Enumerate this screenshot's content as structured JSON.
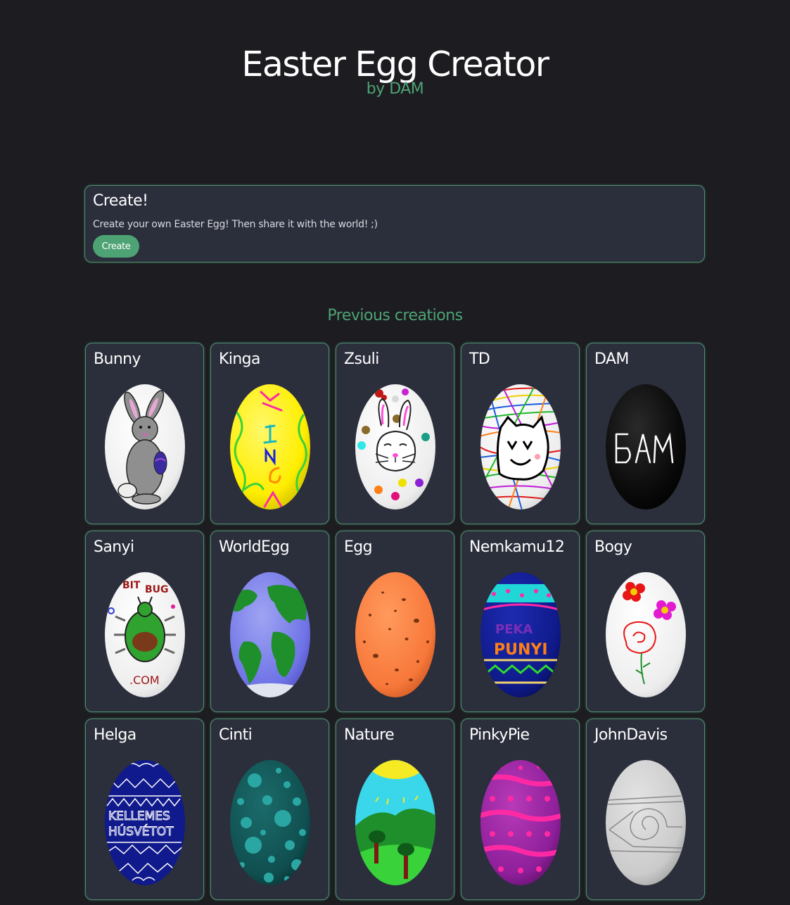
{
  "header": {
    "title": "Easter Egg Creator",
    "subtitle": "by DAM"
  },
  "create": {
    "title": "Create!",
    "description": "Create your own Easter Egg! Then share it with the world! ;)",
    "button_label": "Create"
  },
  "previous": {
    "title": "Previous creations",
    "eggs": [
      {
        "name": "Bunny",
        "icon": "bunny-egg-icon"
      },
      {
        "name": "Kinga",
        "icon": "kinga-egg-icon"
      },
      {
        "name": "Zsuli",
        "icon": "zsuli-egg-icon"
      },
      {
        "name": "TD",
        "icon": "td-egg-icon"
      },
      {
        "name": "DAM",
        "icon": "dam-egg-icon"
      },
      {
        "name": "Sanyi",
        "icon": "sanyi-egg-icon"
      },
      {
        "name": "WorldEgg",
        "icon": "worldegg-egg-icon"
      },
      {
        "name": "Egg",
        "icon": "egg-egg-icon"
      },
      {
        "name": "Nemkamu12",
        "icon": "nemkamu12-egg-icon"
      },
      {
        "name": "Bogy",
        "icon": "bogy-egg-icon"
      },
      {
        "name": "Helga",
        "icon": "helga-egg-icon"
      },
      {
        "name": "Cinti",
        "icon": "cinti-egg-icon"
      },
      {
        "name": "Nature",
        "icon": "nature-egg-icon"
      },
      {
        "name": "PinkyPie",
        "icon": "pinkypie-egg-icon"
      },
      {
        "name": "JohnDavis",
        "icon": "johndavis-egg-icon"
      }
    ]
  },
  "colors": {
    "background": "#1c1c21",
    "card": "#2b2e3b",
    "accent": "#4ea374",
    "border": "#4f8d6d"
  }
}
